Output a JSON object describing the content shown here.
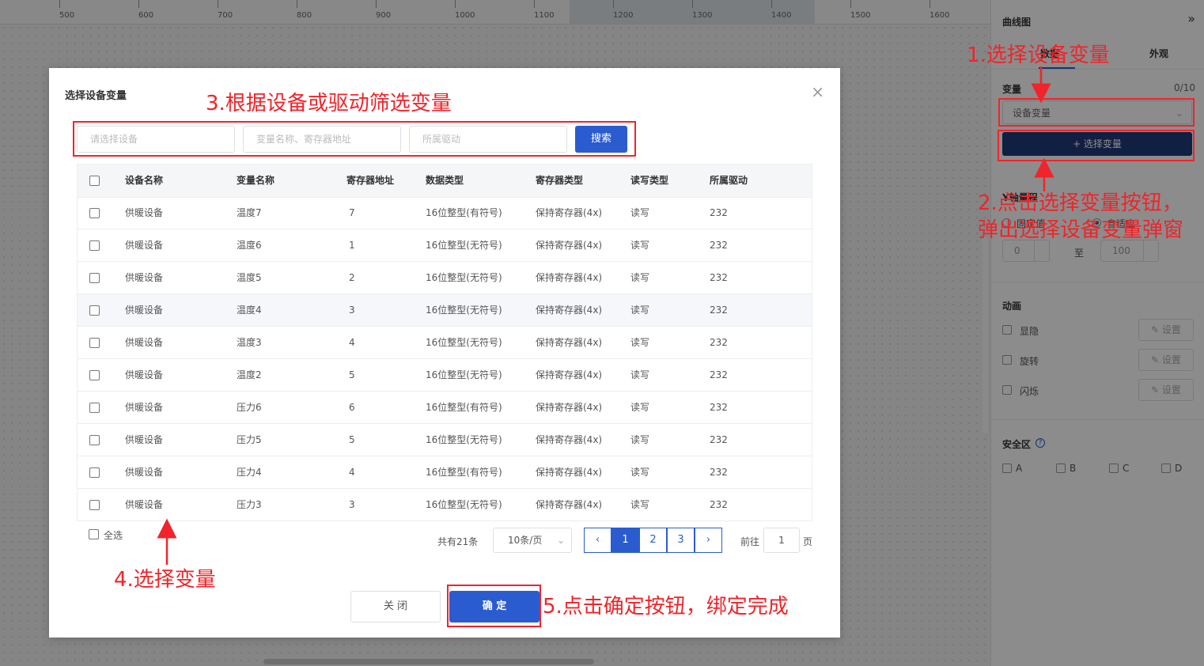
{
  "canvas": {
    "ruler_ticks": [
      "500",
      "600",
      "700",
      "800",
      "900",
      "1000",
      "1100",
      "1200",
      "1300",
      "1400",
      "1500",
      "1600"
    ]
  },
  "panel": {
    "title": "曲线图",
    "collapse_icon": "double-chevron-right-icon",
    "tabs": [
      {
        "label": "数据"
      },
      {
        "label": "外观"
      }
    ],
    "variable_label": "变量",
    "variable_count": "0/10",
    "variable_select": "设备变量",
    "select_variable_button": "+ 选择变量",
    "y_axis_label": "Y轴量程",
    "y_options": [
      {
        "label": "固定值"
      },
      {
        "label": "自适应"
      }
    ],
    "range_min": "0",
    "range_to": "至",
    "range_max": "100",
    "animation_label": "动画",
    "animations": [
      {
        "label": "显隐"
      },
      {
        "label": "旋转"
      },
      {
        "label": "闪烁"
      }
    ],
    "set_button": "设置",
    "safe_zone_label": "安全区",
    "help_glyph": "?",
    "safe_zones": [
      {
        "label": "A"
      },
      {
        "label": "B"
      },
      {
        "label": "C"
      },
      {
        "label": "D"
      }
    ]
  },
  "modal": {
    "title": "选择设备变量",
    "close_glyph": "×",
    "filters": {
      "device_placeholder": "请选择设备",
      "variable_placeholder": "变量名称、寄存器地址",
      "driver_placeholder": "所属驱动",
      "search_button": "搜索"
    },
    "columns": [
      "设备名称",
      "变量名称",
      "寄存器地址",
      "数据类型",
      "寄存器类型",
      "读写类型",
      "所属驱动"
    ],
    "rows": [
      {
        "device": "供暖设备",
        "variable": "温度7",
        "address": "7",
        "data_type": "16位整型(有符号)",
        "register_type": "保持寄存器(4x)",
        "rw": "读写",
        "driver": "232"
      },
      {
        "device": "供暖设备",
        "variable": "温度6",
        "address": "1",
        "data_type": "16位整型(无符号)",
        "register_type": "保持寄存器(4x)",
        "rw": "读写",
        "driver": "232"
      },
      {
        "device": "供暖设备",
        "variable": "温度5",
        "address": "2",
        "data_type": "16位整型(无符号)",
        "register_type": "保持寄存器(4x)",
        "rw": "读写",
        "driver": "232"
      },
      {
        "device": "供暖设备",
        "variable": "温度4",
        "address": "3",
        "data_type": "16位整型(无符号)",
        "register_type": "保持寄存器(4x)",
        "rw": "读写",
        "driver": "232"
      },
      {
        "device": "供暖设备",
        "variable": "温度3",
        "address": "4",
        "data_type": "16位整型(无符号)",
        "register_type": "保持寄存器(4x)",
        "rw": "读写",
        "driver": "232"
      },
      {
        "device": "供暖设备",
        "variable": "温度2",
        "address": "5",
        "data_type": "16位整型(无符号)",
        "register_type": "保持寄存器(4x)",
        "rw": "读写",
        "driver": "232"
      },
      {
        "device": "供暖设备",
        "variable": "压力6",
        "address": "6",
        "data_type": "16位整型(有符号)",
        "register_type": "保持寄存器(4x)",
        "rw": "读写",
        "driver": "232"
      },
      {
        "device": "供暖设备",
        "variable": "压力5",
        "address": "5",
        "data_type": "16位整型(无符号)",
        "register_type": "保持寄存器(4x)",
        "rw": "读写",
        "driver": "232"
      },
      {
        "device": "供暖设备",
        "variable": "压力4",
        "address": "4",
        "data_type": "16位整型(有符号)",
        "register_type": "保持寄存器(4x)",
        "rw": "读写",
        "driver": "232"
      },
      {
        "device": "供暖设备",
        "variable": "压力3",
        "address": "3",
        "data_type": "16位整型(无符号)",
        "register_type": "保持寄存器(4x)",
        "rw": "读写",
        "driver": "232"
      }
    ],
    "select_all": "全选",
    "total": "共有21条",
    "page_size": "10条/页",
    "prev_glyph": "‹",
    "next_glyph": "›",
    "pages": [
      "1",
      "2",
      "3"
    ],
    "current_page": "1",
    "goto_label": "前往",
    "goto_value": "1",
    "goto_unit": "页",
    "close_button": "关 闭",
    "confirm_button": "确 定"
  },
  "annotations": {
    "step1": "1.选择设备变量",
    "step2_line1": "2.点击选择变量按钮，",
    "step2_line2": "弹出选择设备变量弹窗",
    "step3": "3.根据设备或驱动筛选变量",
    "step4": "4.选择变量",
    "step5": "5.点击确定按钮，绑定完成",
    "color": "#f0242a"
  },
  "colors": {
    "primary": "#2a5cd0",
    "dark_button": "#1f3a7a"
  }
}
